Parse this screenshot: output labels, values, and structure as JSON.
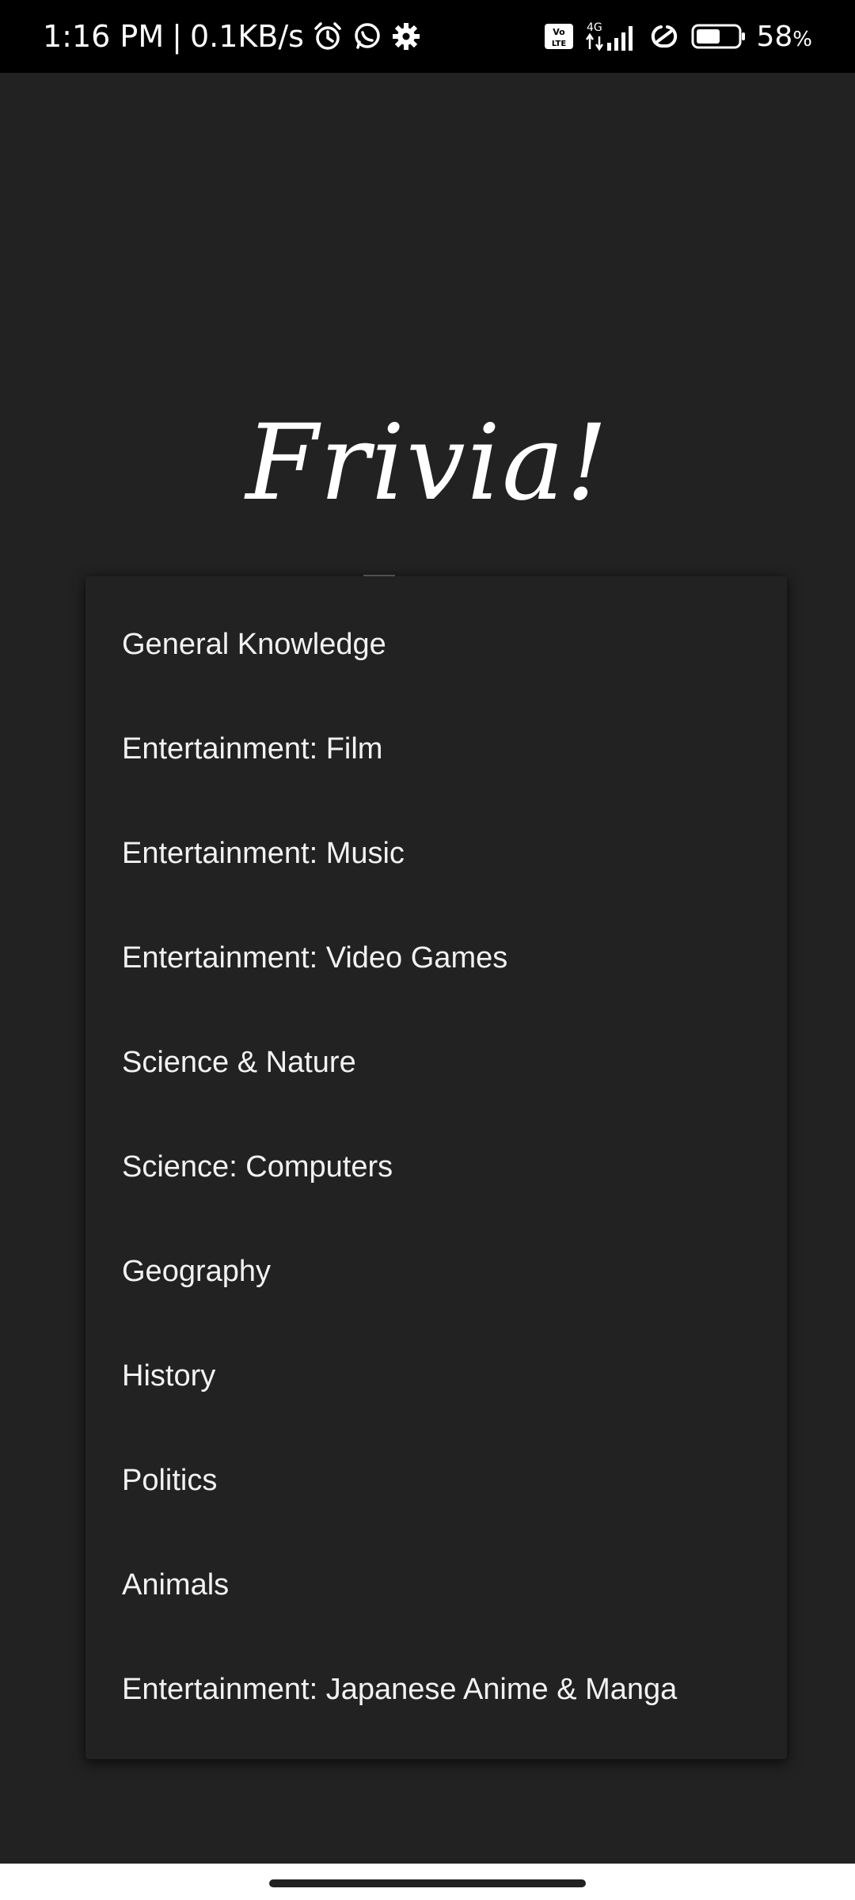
{
  "status_bar": {
    "time": "1:16 PM",
    "separator": "|",
    "speed": "0.1KB/s",
    "network_label": "4G",
    "volte_label": "Vo LTE",
    "battery_percent": "58",
    "battery_suffix": "%",
    "battery_level": 0.58,
    "icons": [
      "alarm-icon",
      "whatsapp-icon",
      "gear-icon",
      "volte-icon",
      "signal-icon",
      "hotspot-icon",
      "battery-icon"
    ]
  },
  "app": {
    "title": "Frivia!"
  },
  "categories": [
    "General Knowledge",
    "Entertainment: Film",
    "Entertainment: Music",
    "Entertainment: Video Games",
    "Science & Nature",
    "Science: Computers",
    "Geography",
    "History",
    "Politics",
    "Animals",
    "Entertainment: Japanese Anime & Manga"
  ],
  "colors": {
    "background": "#222222",
    "status_bar": "#000000",
    "text": "#ffffff"
  }
}
